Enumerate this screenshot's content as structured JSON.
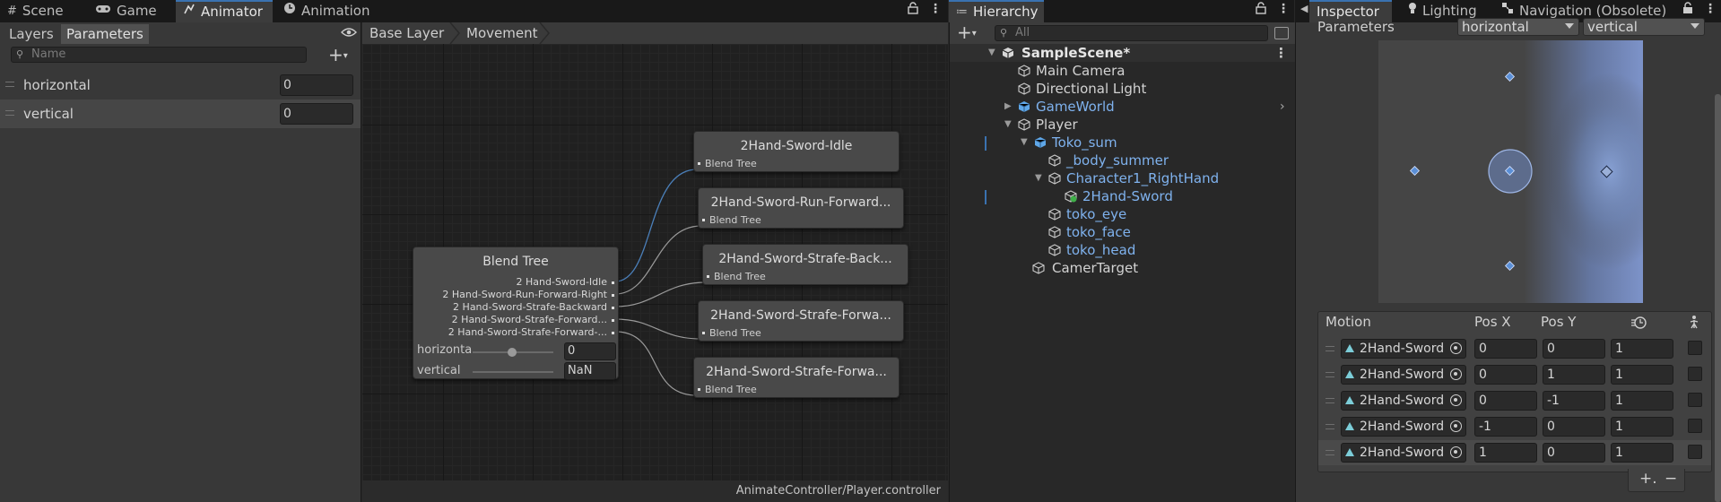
{
  "tabs_left": [
    {
      "label": "Scene",
      "icon": "grid-icon"
    },
    {
      "label": "Game",
      "icon": "gamepad-icon"
    },
    {
      "label": "Animator",
      "icon": "animator-icon",
      "active": true
    },
    {
      "label": "Animation",
      "icon": "clock-icon"
    }
  ],
  "animator": {
    "layers_tab": "Layers",
    "parameters_tab": "Parameters",
    "search_placeholder": "Name",
    "parameters": [
      {
        "name": "horizontal",
        "value": "0"
      },
      {
        "name": "vertical",
        "value": "0"
      }
    ]
  },
  "graph": {
    "breadcrumbs": [
      "Base Layer",
      "Movement"
    ],
    "status_path": "AnimateController/Player.controller",
    "blend_tree": {
      "title": "Blend Tree",
      "outputs": [
        "2 Hand-Sword-Idle",
        "2 Hand-Sword-Run-Forward-Right",
        "2 Hand-Sword-Strafe-Backward",
        "2 Hand-Sword-Strafe-Forward...",
        "2 Hand-Sword-Strafe-Forward-..."
      ],
      "horizontal_label": "horizonta",
      "horizontal_value": "0",
      "vertical_label": "vertical",
      "vertical_value": "NaN"
    },
    "child_nodes": [
      {
        "title": "2Hand-Sword-Idle",
        "subtitle": "Blend Tree"
      },
      {
        "title": "2Hand-Sword-Run-Forward...",
        "subtitle": "Blend Tree"
      },
      {
        "title": "2Hand-Sword-Strafe-Back...",
        "subtitle": "Blend Tree"
      },
      {
        "title": "2Hand-Sword-Strafe-Forwa...",
        "subtitle": "Blend Tree"
      },
      {
        "title": "2Hand-Sword-Strafe-Forwa...",
        "subtitle": "Blend Tree"
      }
    ]
  },
  "hierarchy": {
    "title": "Hierarchy",
    "search_placeholder": "All",
    "items": [
      {
        "label": "SampleScene*",
        "style": "bold",
        "depth": 0
      },
      {
        "label": "Main Camera",
        "style": "normal",
        "depth": 1
      },
      {
        "label": "Directional Light",
        "style": "normal",
        "depth": 1
      },
      {
        "label": "GameWorld",
        "style": "blue",
        "depth": 1
      },
      {
        "label": "Player",
        "style": "normal",
        "depth": 1
      },
      {
        "label": "Toko_sum",
        "style": "blue",
        "depth": 2
      },
      {
        "label": "_body_summer",
        "style": "blue",
        "depth": 3
      },
      {
        "label": "Character1_RightHand",
        "style": "blue",
        "depth": 3
      },
      {
        "label": "2Hand-Sword",
        "style": "blue",
        "depth": 4
      },
      {
        "label": "toko_eye",
        "style": "blue",
        "depth": 3
      },
      {
        "label": "toko_face",
        "style": "blue",
        "depth": 3
      },
      {
        "label": "toko_head",
        "style": "blue",
        "depth": 3
      },
      {
        "label": "CamerTarget",
        "style": "normal",
        "depth": 2
      }
    ]
  },
  "tabs_right": [
    {
      "label": "Inspector",
      "icon": "info-icon",
      "active": true
    },
    {
      "label": "Lighting",
      "icon": "bulb-icon"
    },
    {
      "label": "Navigation (Obsolete)",
      "icon": "navigation-icon"
    }
  ],
  "inspector": {
    "parameters_label": "Parameters",
    "param_x": "horizontal",
    "param_y": "vertical",
    "table_headers": {
      "motion": "Motion",
      "pos_x": "Pos X",
      "pos_y": "Pos Y"
    },
    "motions": [
      {
        "name": "2Hand-Sword",
        "x": "0",
        "y": "0",
        "speed": "1"
      },
      {
        "name": "2Hand-Sword",
        "x": "0",
        "y": "1",
        "speed": "1"
      },
      {
        "name": "2Hand-Sword",
        "x": "0",
        "y": "-1",
        "speed": "1"
      },
      {
        "name": "2Hand-Sword",
        "x": "-1",
        "y": "0",
        "speed": "1"
      },
      {
        "name": "2Hand-Sword",
        "x": "1",
        "y": "0",
        "speed": "1"
      }
    ],
    "add_label": "+.",
    "remove_label": "−"
  },
  "colors": {
    "accent": "#3a72b0",
    "prefab_blue": "#7fb2ee",
    "clip_cyan": "#7ccdd8",
    "point_blue": "#5b8fd6"
  }
}
